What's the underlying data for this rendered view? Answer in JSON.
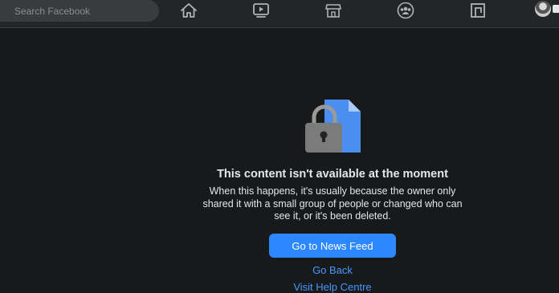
{
  "header": {
    "search": {
      "placeholder": "Search Facebook"
    },
    "nav_icons": [
      "home-icon",
      "watch-icon",
      "marketplace-icon",
      "groups-icon",
      "gaming-icon"
    ],
    "avatar": "profile-avatar"
  },
  "main": {
    "title": "This content isn't available at the moment",
    "description": "When this happens, it's usually because the owner only shared it with a small group of people or changed who can see it, or it's been deleted.",
    "primary_button": "Go to News Feed",
    "back_link": "Go Back",
    "help_link": "Visit Help Centre"
  },
  "colors": {
    "background": "#18191a",
    "topbar": "#242526",
    "accent": "#2d88ff",
    "link": "#4599ff",
    "text": "#e4e6eb"
  }
}
